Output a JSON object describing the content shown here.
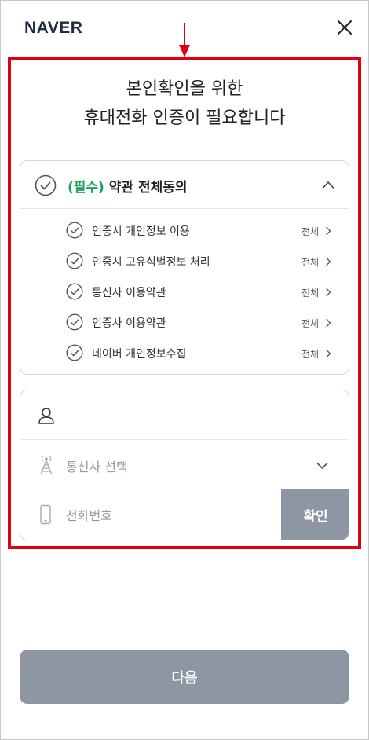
{
  "header": {
    "logo": "NAVER",
    "close_icon": "close-icon",
    "arrow_icon": "down-arrow-icon"
  },
  "title": {
    "line1": "본인확인을 위한",
    "line2": "휴대전화 인증이 필요합니다"
  },
  "terms": {
    "required_tag": "(필수)",
    "all_agree": "약관 전체동의",
    "items": [
      {
        "label": "인증시 개인정보 이용",
        "view": "전체"
      },
      {
        "label": "인증시 고유식별정보 처리",
        "view": "전체"
      },
      {
        "label": "통신사 이용약관",
        "view": "전체"
      },
      {
        "label": "인증사 이용약관",
        "view": "전체"
      },
      {
        "label": "네이버 개인정보수집",
        "view": "전체"
      }
    ]
  },
  "form": {
    "name_value": "",
    "carrier_placeholder": "통신사 선택",
    "phone_placeholder": "전화번호",
    "confirm_label": "확인"
  },
  "footer": {
    "next_label": "다음"
  },
  "colors": {
    "highlight": "#e0000f",
    "required_green": "#1aa35f",
    "button_gray": "#8e95a3",
    "logo_navy": "#1f2a44"
  }
}
